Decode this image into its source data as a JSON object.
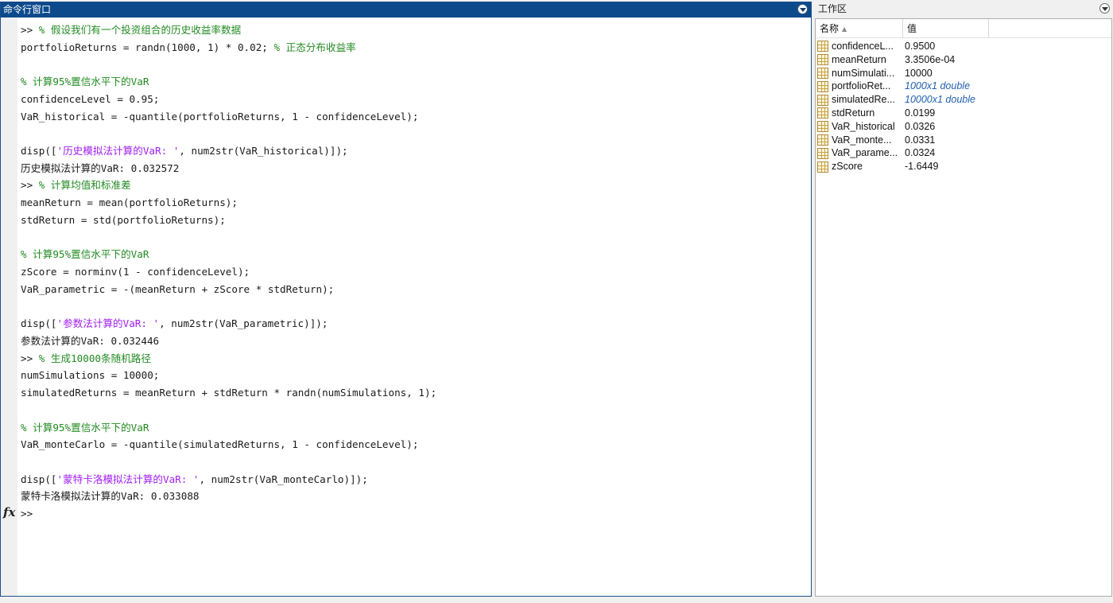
{
  "command_window": {
    "title": "命令行窗口",
    "prompt": ">>",
    "fx_label": "fx",
    "lines": [
      {
        "type": "cmd",
        "segments": [
          {
            "t": ">> ",
            "c": "n"
          },
          {
            "t": "% 假设我们有一个投资组合的历史收益率数据",
            "c": "g"
          }
        ]
      },
      {
        "type": "cmd",
        "segments": [
          {
            "t": "portfolioReturns = randn(1000, 1) * 0.02; ",
            "c": "n"
          },
          {
            "t": "% 正态分布收益率",
            "c": "g"
          }
        ]
      },
      {
        "type": "blank",
        "segments": []
      },
      {
        "type": "cmd",
        "segments": [
          {
            "t": "% 计算95%置信水平下的VaR",
            "c": "g"
          }
        ]
      },
      {
        "type": "cmd",
        "segments": [
          {
            "t": "confidenceLevel = 0.95;",
            "c": "n"
          }
        ]
      },
      {
        "type": "cmd",
        "segments": [
          {
            "t": "VaR_historical = -quantile(portfolioReturns, 1 - confidenceLevel);",
            "c": "n"
          }
        ]
      },
      {
        "type": "blank",
        "segments": []
      },
      {
        "type": "cmd",
        "segments": [
          {
            "t": "disp([",
            "c": "n"
          },
          {
            "t": "'历史模拟法计算的VaR: '",
            "c": "p"
          },
          {
            "t": ", num2str(VaR_historical)]);",
            "c": "n"
          }
        ]
      },
      {
        "type": "out",
        "segments": [
          {
            "t": "历史模拟法计算的VaR: 0.032572",
            "c": "n"
          }
        ]
      },
      {
        "type": "cmd",
        "segments": [
          {
            "t": ">> ",
            "c": "n"
          },
          {
            "t": "% 计算均值和标准差",
            "c": "g"
          }
        ]
      },
      {
        "type": "cmd",
        "segments": [
          {
            "t": "meanReturn = mean(portfolioReturns);",
            "c": "n"
          }
        ]
      },
      {
        "type": "cmd",
        "segments": [
          {
            "t": "stdReturn = std(portfolioReturns);",
            "c": "n"
          }
        ]
      },
      {
        "type": "blank",
        "segments": []
      },
      {
        "type": "cmd",
        "segments": [
          {
            "t": "% 计算95%置信水平下的VaR",
            "c": "g"
          }
        ]
      },
      {
        "type": "cmd",
        "segments": [
          {
            "t": "zScore = norminv(1 - confidenceLevel);",
            "c": "n"
          }
        ]
      },
      {
        "type": "cmd",
        "segments": [
          {
            "t": "VaR_parametric = -(meanReturn + zScore * stdReturn);",
            "c": "n"
          }
        ]
      },
      {
        "type": "blank",
        "segments": []
      },
      {
        "type": "cmd",
        "segments": [
          {
            "t": "disp([",
            "c": "n"
          },
          {
            "t": "'参数法计算的VaR: '",
            "c": "p"
          },
          {
            "t": ", num2str(VaR_parametric)]);",
            "c": "n"
          }
        ]
      },
      {
        "type": "out",
        "segments": [
          {
            "t": "参数法计算的VaR: 0.032446",
            "c": "n"
          }
        ]
      },
      {
        "type": "cmd",
        "segments": [
          {
            "t": ">> ",
            "c": "n"
          },
          {
            "t": "% 生成10000条随机路径",
            "c": "g"
          }
        ]
      },
      {
        "type": "cmd",
        "segments": [
          {
            "t": "numSimulations = 10000;",
            "c": "n"
          }
        ]
      },
      {
        "type": "cmd",
        "segments": [
          {
            "t": "simulatedReturns = meanReturn + stdReturn * randn(numSimulations, 1);",
            "c": "n"
          }
        ]
      },
      {
        "type": "blank",
        "segments": []
      },
      {
        "type": "cmd",
        "segments": [
          {
            "t": "% 计算95%置信水平下的VaR",
            "c": "g"
          }
        ]
      },
      {
        "type": "cmd",
        "segments": [
          {
            "t": "VaR_monteCarlo = -quantile(simulatedReturns, 1 - confidenceLevel);",
            "c": "n"
          }
        ]
      },
      {
        "type": "blank",
        "segments": []
      },
      {
        "type": "cmd",
        "segments": [
          {
            "t": "disp([",
            "c": "n"
          },
          {
            "t": "'蒙特卡洛模拟法计算的VaR: '",
            "c": "p"
          },
          {
            "t": ", num2str(VaR_monteCarlo)]);",
            "c": "n"
          }
        ]
      },
      {
        "type": "out",
        "segments": [
          {
            "t": "蒙特卡洛模拟法计算的VaR: 0.033088",
            "c": "n"
          }
        ]
      },
      {
        "type": "prompt",
        "segments": [
          {
            "t": ">>",
            "c": "n"
          }
        ]
      }
    ]
  },
  "workspace": {
    "title": "工作区",
    "columns": {
      "name": "名称",
      "value": "值"
    },
    "variables": [
      {
        "name": "confidenceL...",
        "value": "0.9500",
        "italic": false
      },
      {
        "name": "meanReturn",
        "value": "3.3506e-04",
        "italic": false
      },
      {
        "name": "numSimulati...",
        "value": "10000",
        "italic": false
      },
      {
        "name": "portfolioRet...",
        "value": "1000x1 double",
        "italic": true
      },
      {
        "name": "simulatedRe...",
        "value": "10000x1 double",
        "italic": true
      },
      {
        "name": "stdReturn",
        "value": "0.0199",
        "italic": false
      },
      {
        "name": "VaR_historical",
        "value": "0.0326",
        "italic": false
      },
      {
        "name": "VaR_monte...",
        "value": "0.0331",
        "italic": false
      },
      {
        "name": "VaR_parame...",
        "value": "0.0324",
        "italic": false
      },
      {
        "name": "zScore",
        "value": "-1.6449",
        "italic": false
      }
    ]
  },
  "colors": {
    "title_bar": "#0c4a8c",
    "comment": "#228b22",
    "string": "#a020f0",
    "text": "#1a1a1a",
    "italic_value": "#2160b0"
  },
  "icons": {
    "panel_menu": "chevron-down-circle-icon",
    "variable": "matrix-variable-icon",
    "sort": "sort-ascending-icon"
  }
}
